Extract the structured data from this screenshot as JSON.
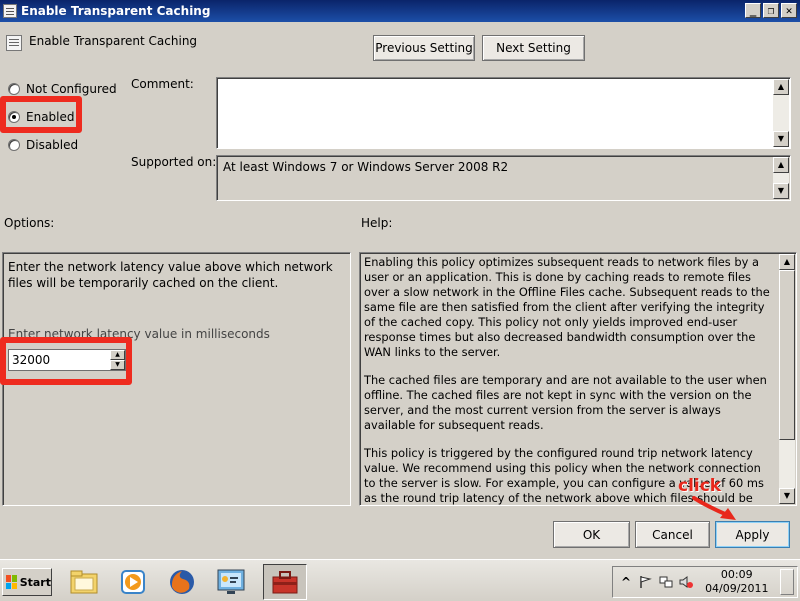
{
  "window": {
    "title": "Enable Transparent Caching",
    "header_title": "Enable Transparent Caching",
    "controls": {
      "minimize": "_",
      "restore": "❐",
      "close": "✕"
    }
  },
  "nav": {
    "previous_label": "Previous Setting",
    "next_label": "Next Setting"
  },
  "state": {
    "options": [
      "Not Configured",
      "Enabled",
      "Disabled"
    ],
    "selected": "Enabled"
  },
  "comment": {
    "label": "Comment:",
    "value": ""
  },
  "supported": {
    "label": "Supported on:",
    "value": "At least Windows 7 or Windows Server 2008 R2"
  },
  "options_panel": {
    "label": "Options:",
    "description": "Enter the network latency value above which network files will be temporarily cached on the client.",
    "field_label": "Enter network latency value in milliseconds",
    "field_value": "32000"
  },
  "help_panel": {
    "label": "Help:",
    "paragraphs": [
      "Enabling this policy optimizes subsequent reads to network files by a user or an application. This is done by caching reads to remote files over a slow network in the Offline Files cache. Subsequent reads to the same file are then satisfied from the client after verifying the integrity of the cached copy. This policy not only yields improved end-user response times but also decreased bandwidth consumption over the WAN links to the server.",
      "The cached files are temporary and are not available to the user when offline. The cached files are not kept in sync with the version on the server, and the most current version from the server is always available for subsequent reads.",
      "This policy is triggered by the configured round trip network latency value. We recommend using this policy when the network connection to the server is slow. For example, you can configure a value of 60 ms as the round trip latency of the network above which files should be transparently cached in the Offline Files cache. If the round trip latency of the network is less than"
    ]
  },
  "annotation": {
    "text": "click",
    "color": "#e8281c"
  },
  "dialog_buttons": {
    "ok": "OK",
    "cancel": "Cancel",
    "apply": "Apply"
  },
  "taskbar": {
    "start_label": "Start",
    "apps": [
      "explorer-icon",
      "media-player-icon",
      "firefox-icon",
      "control-panel-icon",
      "toolbox-icon"
    ],
    "tray_expand": "^",
    "clock_time": "00:09",
    "clock_date": "04/09/2011"
  },
  "colors": {
    "highlight": "#ee2b1f",
    "titlebar": "#0a246a"
  }
}
